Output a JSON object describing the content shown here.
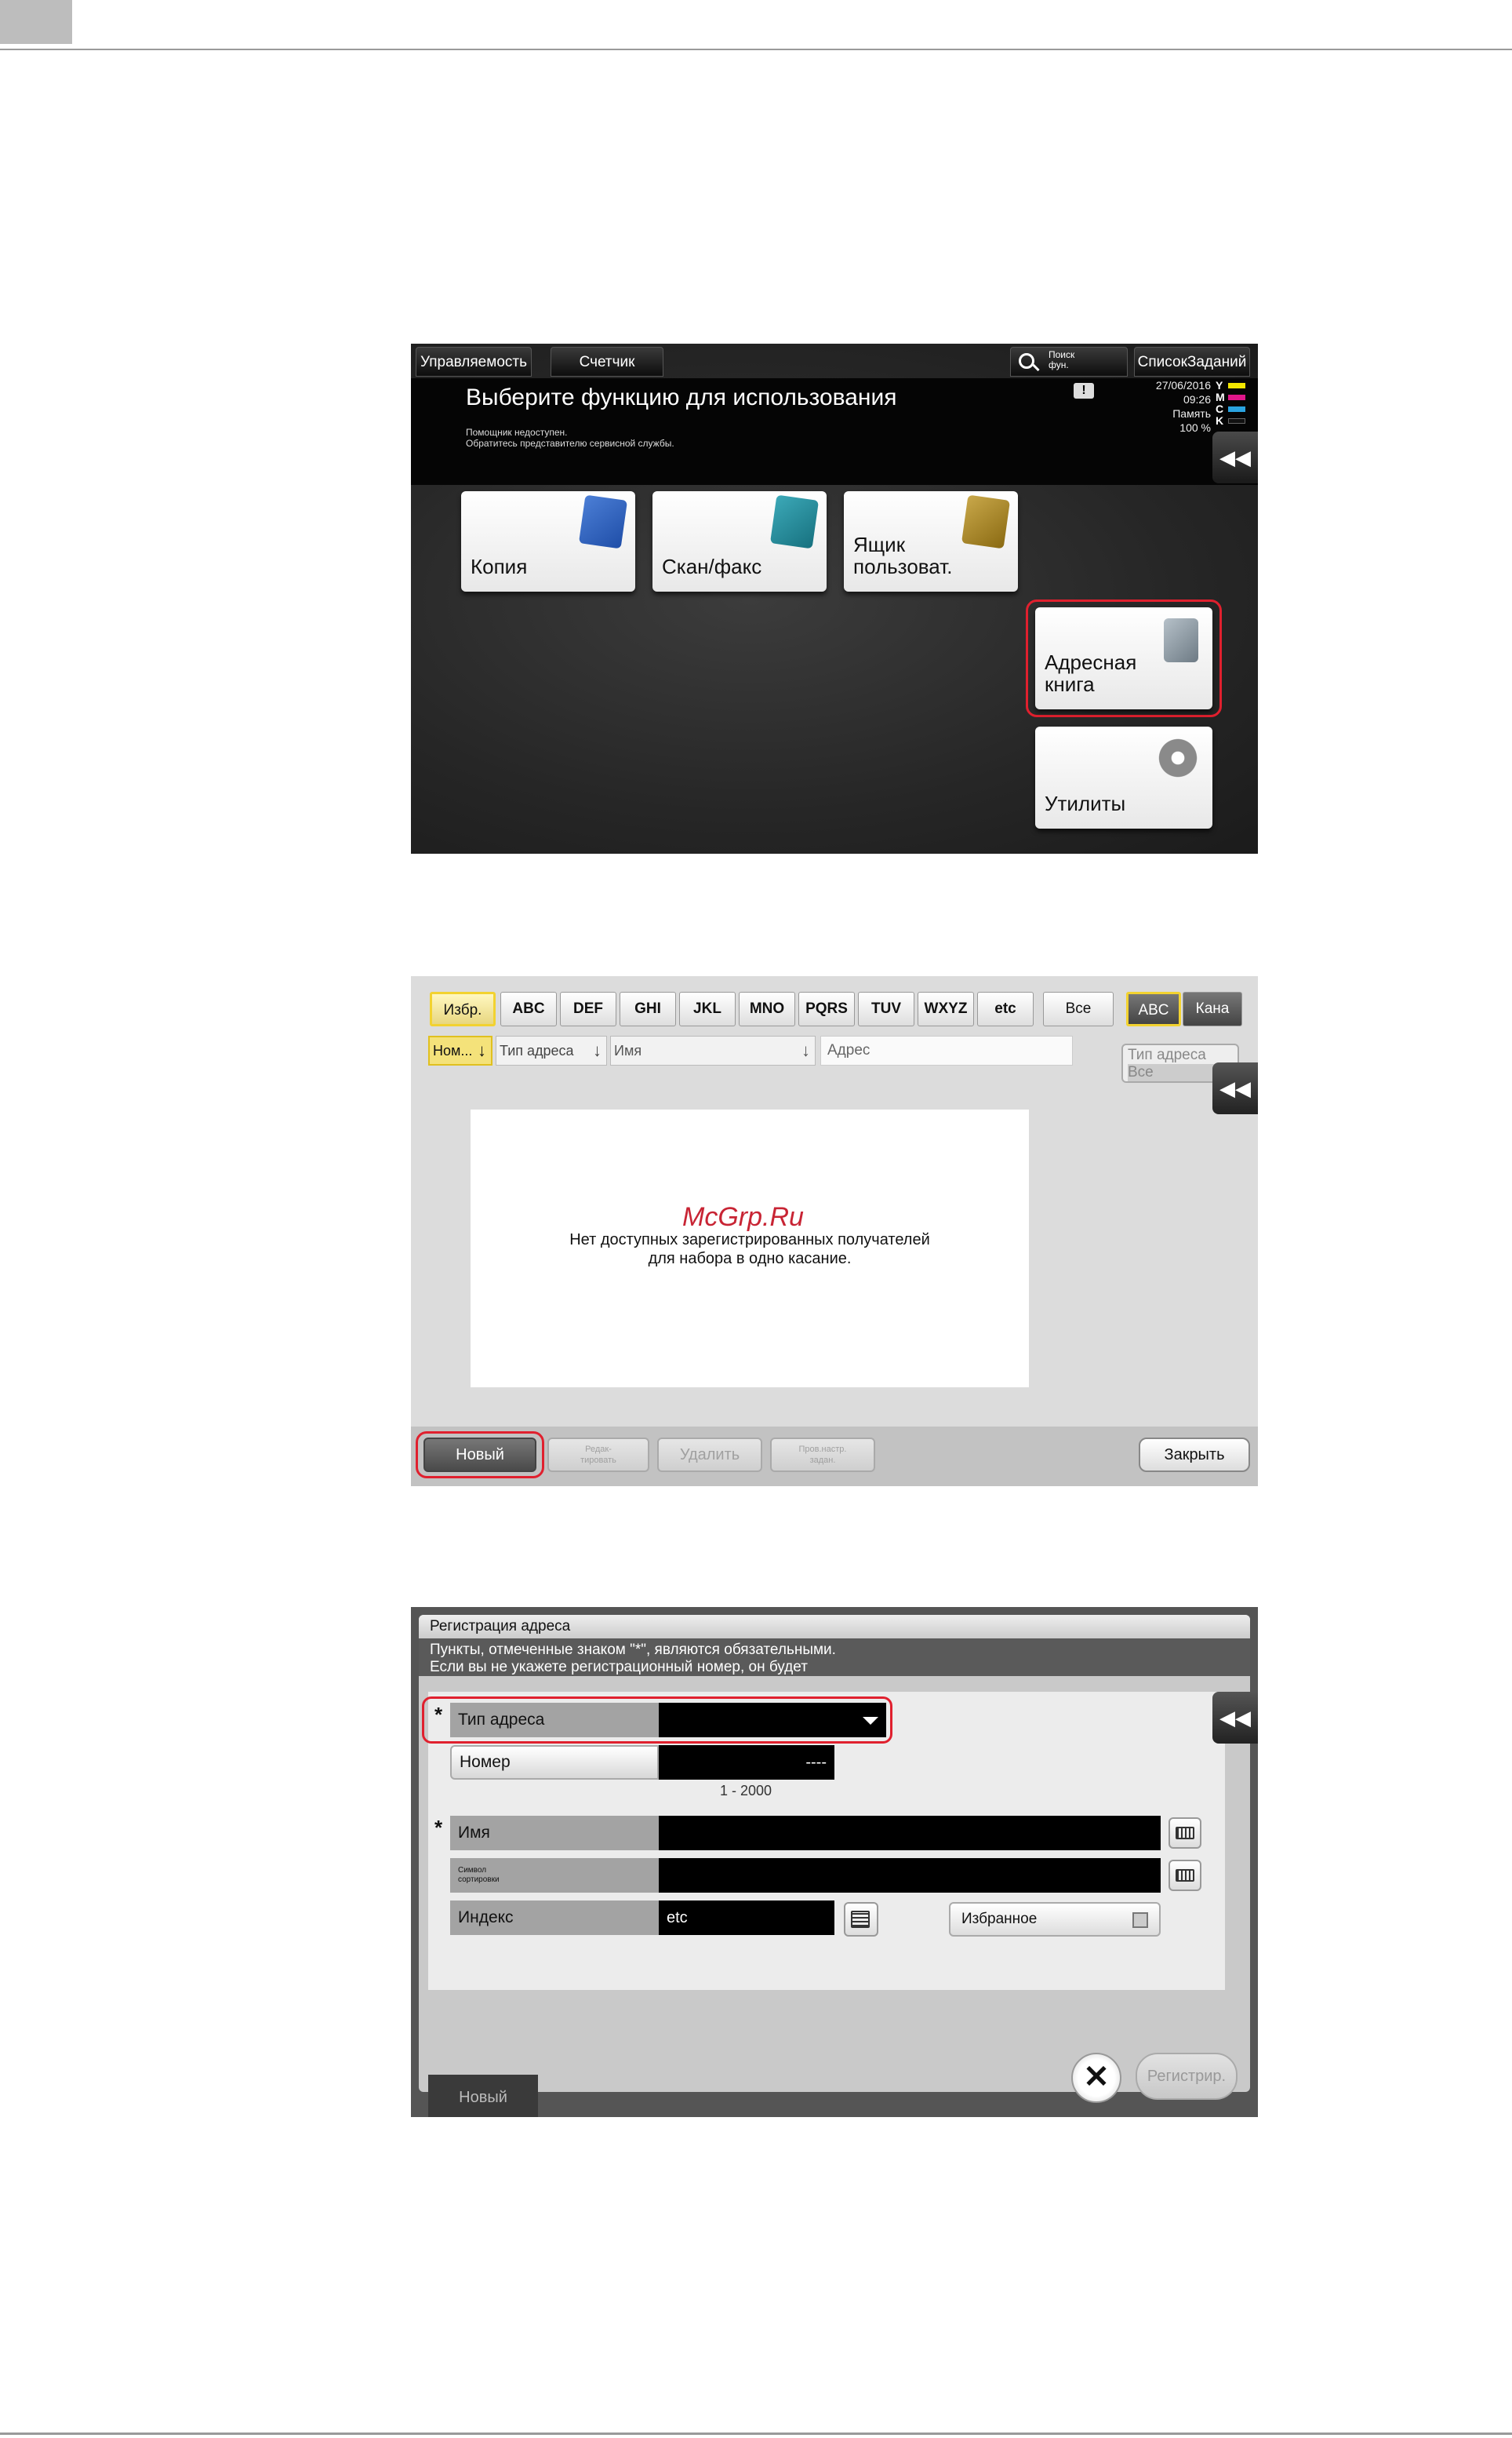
{
  "home": {
    "tab_manage": "Управляемость",
    "tab_counter": "Счетчик",
    "search_line1": "Поиск",
    "search_line2": "фун.",
    "job_list": "СписокЗаданий",
    "title": "Выберите функцию для использования",
    "msg_line1": "Помощник недоступен.",
    "msg_line2": "Обратитесь представителю сервисной службы.",
    "date": "27/06/2016",
    "time": "09:26",
    "memory_label": "Память",
    "memory_value": "100 %",
    "toner": [
      {
        "label": "Y",
        "color": "#f2e600"
      },
      {
        "label": "M",
        "color": "#e0168a"
      },
      {
        "label": "C",
        "color": "#2aa3e0"
      },
      {
        "label": "K",
        "color": "#111111"
      }
    ],
    "tiles": {
      "copy": "Копия",
      "scan_line1": "Скан/факс",
      "box_line1": "Ящик",
      "box_line2": "пользоват.",
      "addr_line1": "Адресная",
      "addr_line2": "книга",
      "util": "Утилиты"
    },
    "back": "◀◀"
  },
  "abook": {
    "fav": "Избр.",
    "alpha": [
      "ABC",
      "DEF",
      "GHI",
      "JKL",
      "MNO",
      "PQRS",
      "TUV",
      "WXYZ",
      "etc"
    ],
    "all": "Все",
    "abc": "ABC",
    "kana": "Кана",
    "sort_num": "Ном...",
    "sort_type": "Тип адреса",
    "sort_name": "Имя",
    "col_addr": "Адрес",
    "filter_label": "Тип адреса",
    "filter_value": "Все",
    "empty_line1": "Нет доступных зарегистрированных получателей",
    "empty_line2": "для набора в одно касание.",
    "watermark": "McGrp.Ru",
    "btn_new": "Новый",
    "btn_edit_l1": "Редак-",
    "btn_edit_l2": "тировать",
    "btn_delete": "Удалить",
    "btn_prog_l1": "Пров.настр.",
    "btn_prog_l2": "задан.",
    "btn_close": "Закрыть",
    "back": "◀◀"
  },
  "reg": {
    "title": "Регистрация адреса",
    "note_line1": "Пункты, отмеченные знаком \"*\", являются обязательными.",
    "note_line2": "Если вы не укажете регистрационный номер, он будет",
    "type_label": "Тип адреса",
    "number_label": "Номер",
    "number_value": "----",
    "range": "1 - 2000",
    "name_label": "Имя",
    "sort_label_l1": "Символ",
    "sort_label_l2": "сортировки",
    "index_label": "Индекс",
    "index_value": "etc",
    "favorite_label": "Избранное",
    "star": "*",
    "btn_new": "Новый",
    "btn_register": "Регистрир.",
    "close_glyph": "✕",
    "back": "◀◀"
  }
}
